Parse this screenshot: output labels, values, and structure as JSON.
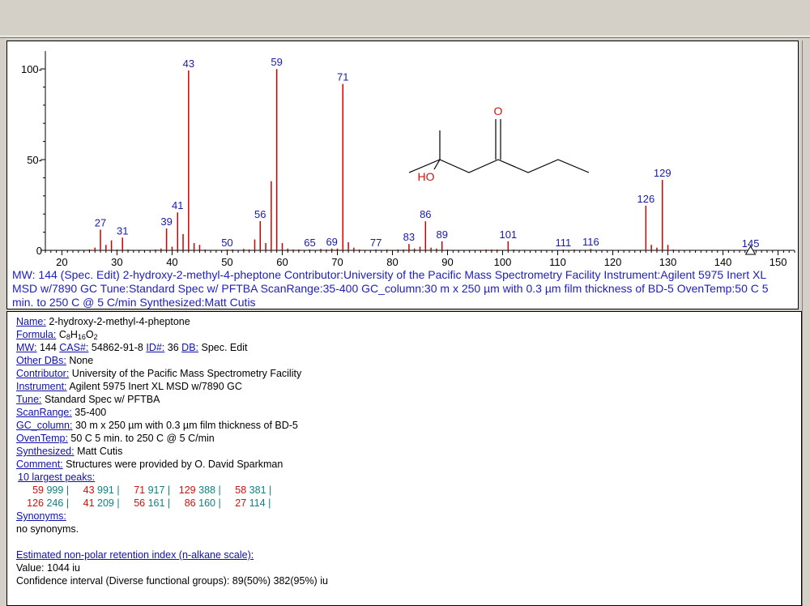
{
  "spectrum": {
    "caption": "MW: 144 (Spec. Edit) 2-hydroxy-2-methyl-4-pheptone Contributor:University of the Pacific Mass Spectrometry Facility Instrument:Agilent 5975 Inert XL MSD w/7890 GC Tune:Standard Spec w/ PFTBA ScanRange:35-400 GC_column:30 m x 250 µm with 0.3 µm film thickness of BD-5 OvenTemp:50 C 5 min. to 250 C @ 5 C/min Synthesized:Matt Cutis",
    "structure_labels": {
      "oxygen": "O",
      "hydroxyl": "HO"
    },
    "colors": {
      "peaks": "#cc0000",
      "labels": "#1a1aaa",
      "axis": "#000000"
    }
  },
  "chart_data": {
    "type": "bar",
    "title": "",
    "xlabel": "",
    "ylabel": "",
    "xlim": [
      17,
      153
    ],
    "ylim": [
      0,
      110
    ],
    "xticks": [
      20,
      30,
      40,
      50,
      60,
      70,
      80,
      90,
      100,
      110,
      120,
      130,
      140,
      150
    ],
    "yticks": [
      0,
      50,
      100
    ],
    "peaks": [
      {
        "mz": 25,
        "i": 0.5
      },
      {
        "mz": 26,
        "i": 1.5
      },
      {
        "mz": 27,
        "i": 11.4,
        "label": "27"
      },
      {
        "mz": 28,
        "i": 3
      },
      {
        "mz": 29,
        "i": 5.5
      },
      {
        "mz": 30,
        "i": 0.5
      },
      {
        "mz": 31,
        "i": 7,
        "label": "31"
      },
      {
        "mz": 32,
        "i": 0.5
      },
      {
        "mz": 37,
        "i": 0.5
      },
      {
        "mz": 38,
        "i": 1
      },
      {
        "mz": 39,
        "i": 12,
        "label": "39"
      },
      {
        "mz": 40,
        "i": 2
      },
      {
        "mz": 41,
        "i": 20.9,
        "label": "41"
      },
      {
        "mz": 42,
        "i": 9
      },
      {
        "mz": 43,
        "i": 99.1,
        "label": "43"
      },
      {
        "mz": 44,
        "i": 4
      },
      {
        "mz": 45,
        "i": 3
      },
      {
        "mz": 46,
        "i": 0.5
      },
      {
        "mz": 50,
        "i": 0.5,
        "label": "50"
      },
      {
        "mz": 51,
        "i": 0.5
      },
      {
        "mz": 53,
        "i": 0.8
      },
      {
        "mz": 54,
        "i": 0.5
      },
      {
        "mz": 55,
        "i": 6
      },
      {
        "mz": 56,
        "i": 16.1,
        "label": "56"
      },
      {
        "mz": 57,
        "i": 4
      },
      {
        "mz": 58,
        "i": 38.1
      },
      {
        "mz": 59,
        "i": 99.9,
        "label": "59"
      },
      {
        "mz": 60,
        "i": 4
      },
      {
        "mz": 61,
        "i": 1
      },
      {
        "mz": 62,
        "i": 0.5
      },
      {
        "mz": 63,
        "i": 0.5
      },
      {
        "mz": 65,
        "i": 0.5,
        "label": "65"
      },
      {
        "mz": 67,
        "i": 0.8
      },
      {
        "mz": 68,
        "i": 0.5
      },
      {
        "mz": 69,
        "i": 1,
        "label": "69"
      },
      {
        "mz": 70,
        "i": 1
      },
      {
        "mz": 71,
        "i": 91.7,
        "label": "71"
      },
      {
        "mz": 72,
        "i": 4.5
      },
      {
        "mz": 73,
        "i": 1.5
      },
      {
        "mz": 74,
        "i": 0.5
      },
      {
        "mz": 77,
        "i": 0.5,
        "label": "77"
      },
      {
        "mz": 79,
        "i": 0.5
      },
      {
        "mz": 81,
        "i": 0.5
      },
      {
        "mz": 82,
        "i": 0.5
      },
      {
        "mz": 83,
        "i": 3.5,
        "label": "83"
      },
      {
        "mz": 84,
        "i": 1
      },
      {
        "mz": 85,
        "i": 2
      },
      {
        "mz": 86,
        "i": 16,
        "label": "86"
      },
      {
        "mz": 87,
        "i": 1.5
      },
      {
        "mz": 88,
        "i": 1
      },
      {
        "mz": 89,
        "i": 5,
        "label": "89"
      },
      {
        "mz": 90,
        "i": 0.5
      },
      {
        "mz": 97,
        "i": 0.5
      },
      {
        "mz": 98,
        "i": 0.5
      },
      {
        "mz": 99,
        "i": 0.5
      },
      {
        "mz": 101,
        "i": 5,
        "label": "101"
      },
      {
        "mz": 102,
        "i": 0.5
      },
      {
        "mz": 111,
        "i": 0.5,
        "label": "111"
      },
      {
        "mz": 113,
        "i": 0.5
      },
      {
        "mz": 116,
        "i": 0.8,
        "label": "116"
      },
      {
        "mz": 126,
        "i": 24.6,
        "label": "126"
      },
      {
        "mz": 127,
        "i": 3
      },
      {
        "mz": 128,
        "i": 1.5
      },
      {
        "mz": 129,
        "i": 38.8,
        "label": "129"
      },
      {
        "mz": 130,
        "i": 3
      },
      {
        "mz": 131,
        "i": 0.5
      },
      {
        "mz": 145,
        "i": 0,
        "label": "145",
        "marker": true
      }
    ]
  },
  "details": {
    "name_label": "Name:",
    "name": "2-hydroxy-2-methyl-4-pheptone",
    "formula_label": "Formula:",
    "formula": {
      "c": "C",
      "c_n": "8",
      "h": "H",
      "h_n": "16",
      "o": "O",
      "o_n": "2"
    },
    "mw_label": "MW:",
    "mw": "144",
    "cas_label": "CAS#:",
    "cas": "54862-91-8",
    "id_label": "ID#:",
    "id": "36",
    "db_label": "DB:",
    "db": "Spec. Edit",
    "other_dbs_label": "Other DBs:",
    "other_dbs": "None",
    "contributor_label": "Contributor:",
    "contributor": "University of the Pacific Mass Spectrometry Facility",
    "instrument_label": "Instrument:",
    "instrument": "Agilent 5975 Inert XL MSD w/7890 GC",
    "tune_label": "Tune:",
    "tune": "Standard Spec w/ PFTBA",
    "scanrange_label": "ScanRange:",
    "scanrange": "35-400",
    "gc_column_label": "GC_column:",
    "gc_column": "30 m x 250 µm with 0.3 µm film thickness of BD-5",
    "oventemp_label": "OvenTemp:",
    "oventemp": "50 C 5 min. to 250 C @ 5 C/min",
    "synthesized_label": "Synthesized:",
    "synthesized": "Matt Cutis",
    "comment_label": "Comment:",
    "comment": "Structures were provided by O. David Sparkman",
    "largest_peaks_label": "10 largest peaks:",
    "largest_peaks_row1": [
      {
        "mz": "59",
        "int": "999"
      },
      {
        "mz": "43",
        "int": "991"
      },
      {
        "mz": "71",
        "int": "917"
      },
      {
        "mz": "129",
        "int": "388"
      },
      {
        "mz": "58",
        "int": "381"
      }
    ],
    "largest_peaks_row2": [
      {
        "mz": "126",
        "int": "246"
      },
      {
        "mz": "41",
        "int": "209"
      },
      {
        "mz": "56",
        "int": "161"
      },
      {
        "mz": "86",
        "int": "160"
      },
      {
        "mz": "27",
        "int": "114"
      }
    ],
    "separator": "|",
    "synonyms_label": "Synonyms:",
    "synonyms": "no synonyms.",
    "ri_label": "Estimated non-polar retention index (n-alkane scale):",
    "ri_value": "Value: 1044 iu",
    "ri_confidence": "Confidence interval (Diverse functional groups):  89(50%) 382(95%) iu"
  }
}
